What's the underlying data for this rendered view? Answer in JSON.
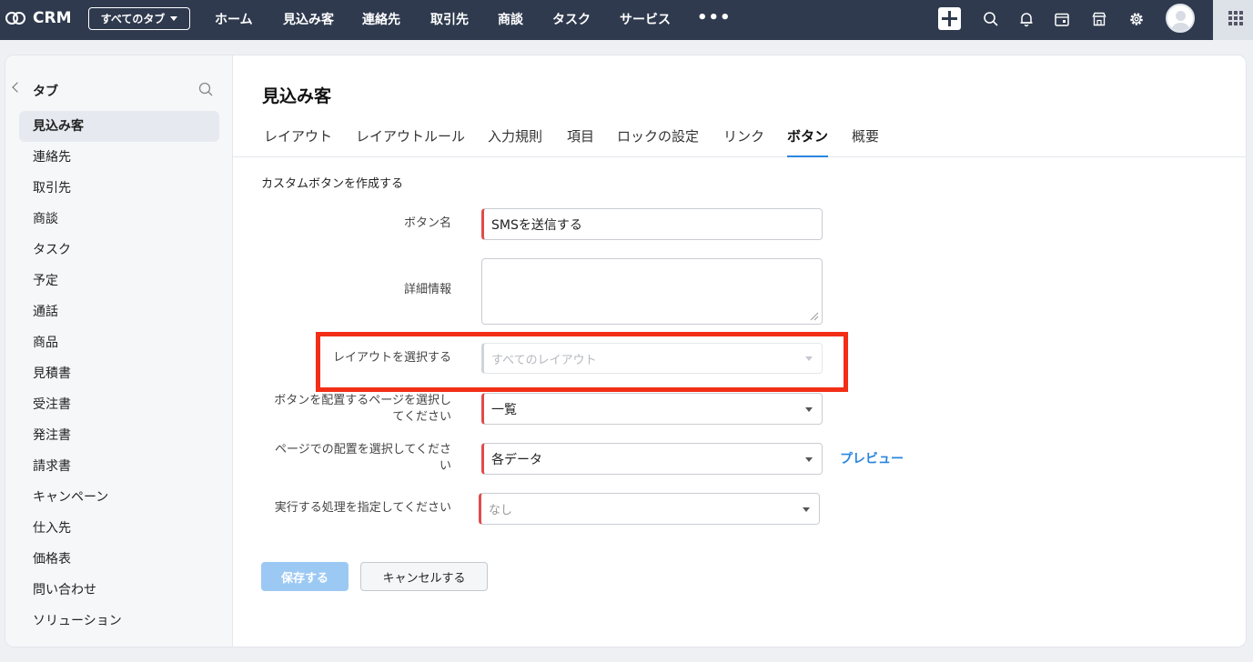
{
  "app": {
    "name": "CRM"
  },
  "topnav": {
    "tabs_selector": "すべてのタブ",
    "links": [
      "ホーム",
      "見込み客",
      "連絡先",
      "取引先",
      "商談",
      "タスク",
      "サービス"
    ],
    "more": "•••",
    "icons": [
      "plus-icon",
      "search-icon",
      "bell-icon",
      "calendar-icon",
      "store-icon",
      "gear-icon",
      "avatar",
      "apps-grid-icon"
    ]
  },
  "sidebar": {
    "title": "タブ",
    "items": [
      "見込み客",
      "連絡先",
      "取引先",
      "商談",
      "タスク",
      "予定",
      "通話",
      "商品",
      "見積書",
      "受注書",
      "発注書",
      "請求書",
      "キャンペーン",
      "仕入先",
      "価格表",
      "問い合わせ",
      "ソリューション"
    ],
    "active": "見込み客"
  },
  "page": {
    "title": "見込み客",
    "tabs": [
      "レイアウト",
      "レイアウトルール",
      "入力規則",
      "項目",
      "ロックの設定",
      "リンク",
      "ボタン",
      "概要"
    ],
    "active_tab": "ボタン",
    "section_title": "カスタムボタンを作成する"
  },
  "form": {
    "button_name": {
      "label": "ボタン名",
      "value": "SMSを送信する"
    },
    "details": {
      "label": "詳細情報",
      "value": ""
    },
    "layout": {
      "label": "レイアウトを選択する",
      "value": "すべてのレイアウト"
    },
    "page_select": {
      "label_line1": "ボタンを配置するページを選択し",
      "label_line2": "てください",
      "value": "一覧"
    },
    "placement": {
      "label_line1": "ページでの配置を選択してくださ",
      "label_line2": "い",
      "value": "各データ"
    },
    "action": {
      "label": "実行する処理を指定してください",
      "value": "なし"
    },
    "preview_link": "プレビュー",
    "save_button": "保存する",
    "cancel_button": "キャンセルする"
  },
  "colors": {
    "topnav_bg": "#2f3a4e",
    "accent": "#2b86e0",
    "required_marker": "#e04b4b",
    "highlight_box": "#f22e17"
  }
}
